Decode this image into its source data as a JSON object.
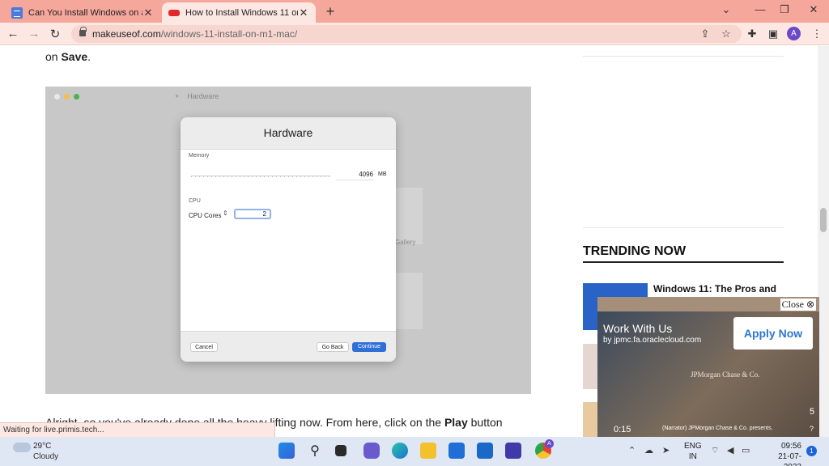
{
  "browser": {
    "tabs": [
      {
        "title": "Can You Install Windows on an A",
        "close": "✕"
      },
      {
        "title": "How to Install Windows 11 on Yo",
        "close": "✕"
      }
    ],
    "new_tab": "+",
    "window_controls": {
      "minimize": "⌄",
      "restore": "—",
      "maximize": "❐",
      "close": "✕"
    },
    "url_domain": "makeuseof.com",
    "url_path": "/windows-11-install-on-m1-mac/",
    "profile_initial": "A"
  },
  "article": {
    "lead_prefix": "on ",
    "lead_bold": "Save",
    "lead_suffix": ".",
    "para_prefix": "Alright, so you've already done all the heavy lifting now. From here, click on the ",
    "para_bold": "Play",
    "para_suffix": " button"
  },
  "screenshot": {
    "bg_header": "Hardware",
    "bg_label": "Gallery",
    "dialog_title": "Hardware",
    "memory_label": "Memory",
    "memory_value": "4096",
    "memory_unit": "MB",
    "cpu_section": "CPU",
    "cpu_label": "CPU Cores",
    "cpu_value": "2",
    "cancel": "Cancel",
    "go_back": "Go Back",
    "continue": "Continue"
  },
  "sidebar": {
    "trending_title": "TRENDING NOW",
    "article_1": "Windows 11: The Pros and"
  },
  "ad": {
    "close_label": "Close ⊗",
    "headline": "Work With Us",
    "subline": "by jpmc.fa.oraclecloud.com",
    "cta": "Apply Now",
    "brand": "JPMorgan Chase & Co.",
    "time": "0:15",
    "counter": "5",
    "narration": "(Narrator) JPMorgan Chase & Co. presents.",
    "help": "?"
  },
  "status_text": "Waiting for live.primis.tech...",
  "taskbar": {
    "temp": "29°C",
    "condition": "Cloudy",
    "lang_1": "ENG",
    "lang_2": "IN",
    "time": "09:56",
    "date": "21-07-2022",
    "notifications": "1",
    "chrome_badge": "A"
  }
}
